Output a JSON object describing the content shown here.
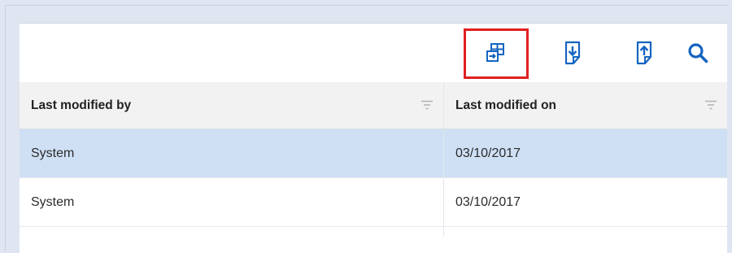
{
  "toolbar": {
    "buttons": [
      {
        "icon": "split-view-icon",
        "highlighted": true
      },
      {
        "icon": "download-file-icon",
        "highlighted": false
      },
      {
        "icon": "upload-file-icon",
        "highlighted": false
      },
      {
        "icon": "search-icon",
        "highlighted": false
      }
    ],
    "accent_color": "#1565c0",
    "highlight_color": "#e02020"
  },
  "table": {
    "columns": [
      "Last modified by",
      "Last modified on"
    ],
    "rows": [
      {
        "modified_by": "System",
        "modified_on": "03/10/2017",
        "selected": true
      },
      {
        "modified_by": "System",
        "modified_on": "03/10/2017",
        "selected": false
      }
    ],
    "selected_row_color": "#cfe0f5"
  }
}
